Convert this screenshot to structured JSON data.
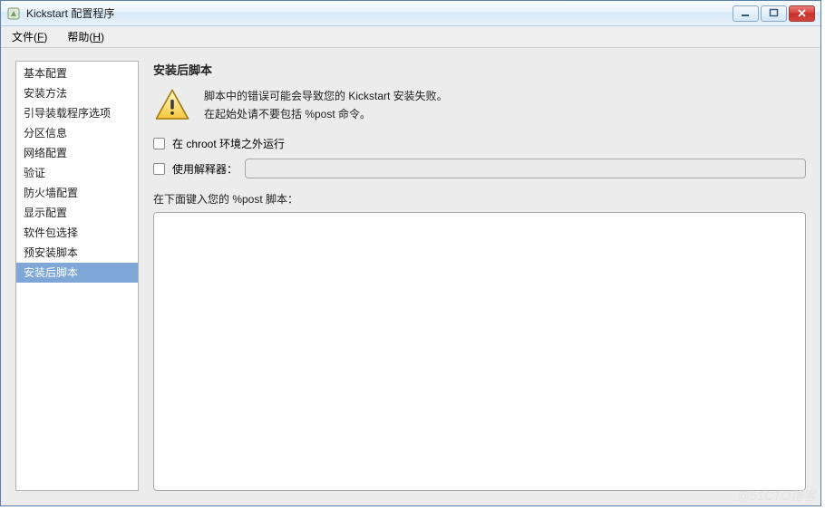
{
  "window": {
    "title": "Kickstart 配置程序"
  },
  "menu": {
    "file": "文件(F)",
    "help": "帮助(H)"
  },
  "sidebar": {
    "items": [
      {
        "label": "基本配置"
      },
      {
        "label": "安装方法"
      },
      {
        "label": "引导装载程序选项"
      },
      {
        "label": "分区信息"
      },
      {
        "label": "网络配置"
      },
      {
        "label": "验证"
      },
      {
        "label": "防火墙配置"
      },
      {
        "label": "显示配置"
      },
      {
        "label": "软件包选择"
      },
      {
        "label": "预安装脚本"
      },
      {
        "label": "安装后脚本"
      }
    ],
    "selected_index": 10
  },
  "page": {
    "title": "安装后脚本",
    "warning_line1": "脚本中的错误可能会导致您的  Kickstart  安装失败。",
    "warning_line2": "在起始处请不要包括  %post 命令。",
    "chroot_label": "在  chroot 环境之外运行",
    "chroot_checked": false,
    "interpreter_label": "使用解释器：",
    "interpreter_checked": false,
    "interpreter_value": "",
    "prompt": "在下面键入您的 %post 脚本：",
    "script_value": ""
  },
  "watermark": "@51CTO博客"
}
